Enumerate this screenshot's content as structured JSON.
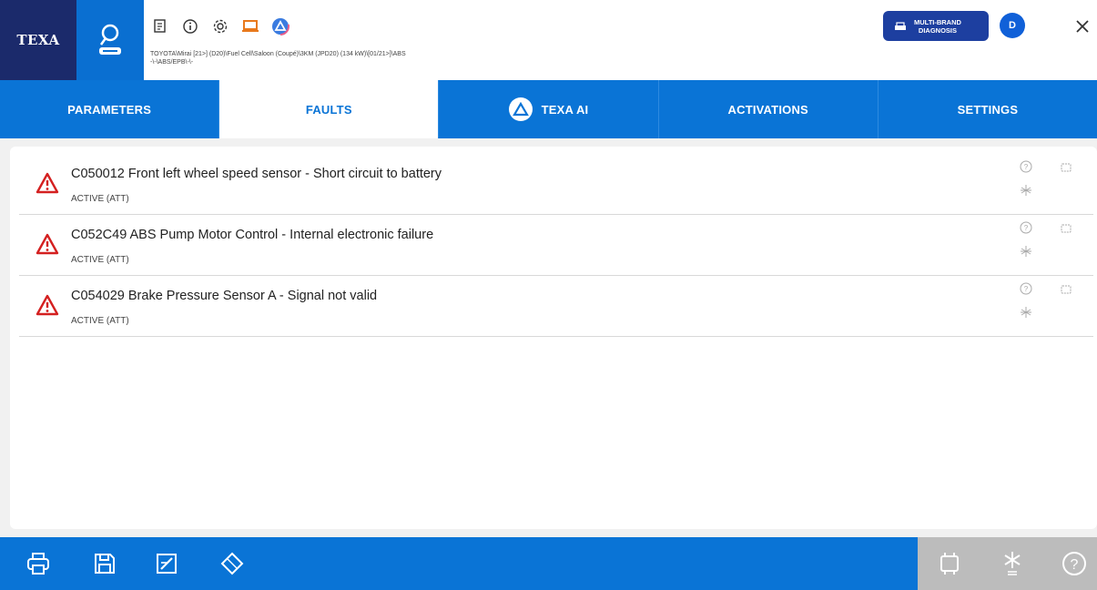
{
  "header": {
    "logo_text": "TEXA",
    "vehicle_path_line1": "TOYOTA\\Mirai [21>] (D20)\\Fuel Cell\\Saloon (Coupé)\\3KM (JPD20) (134 kW)\\[01/21>]\\ABS",
    "vehicle_path_line2": "-\\-\\ABS/EPB\\-\\-",
    "multibrand_line1": "MULTI-BRAND",
    "multibrand_line2": "DIAGNOSIS",
    "avatar_initial": "D",
    "toolbar_icons": [
      "report-icon",
      "info-icon",
      "gear-icon",
      "laptop-icon",
      "texa-ai-icon"
    ]
  },
  "tabs": [
    {
      "label": "PARAMETERS",
      "active": false
    },
    {
      "label": "FAULTS",
      "active": true
    },
    {
      "label": "TEXA AI",
      "active": false
    },
    {
      "label": "ACTIVATIONS",
      "active": false
    },
    {
      "label": "SETTINGS",
      "active": false
    }
  ],
  "faults": [
    {
      "code_text": "C050012 Front left wheel speed sensor - Short circuit to battery",
      "status": "ACTIVE (ATT)"
    },
    {
      "code_text": "C052C49 ABS Pump Motor Control - Internal electronic failure",
      "status": "ACTIVE (ATT)"
    },
    {
      "code_text": "C054029 Brake Pressure Sensor A - Signal not valid",
      "status": "ACTIVE (ATT)"
    }
  ],
  "footer": {
    "left_icons": [
      "print-icon",
      "save-icon",
      "edit-document-icon",
      "eraser-icon"
    ],
    "right_icons": [
      "ecu-icon",
      "freeze-frame-icon",
      "help-icon"
    ]
  },
  "colors": {
    "brand_dark": "#1b2a6b",
    "brand_blue": "#0a74d6",
    "warning_red": "#d42020"
  }
}
